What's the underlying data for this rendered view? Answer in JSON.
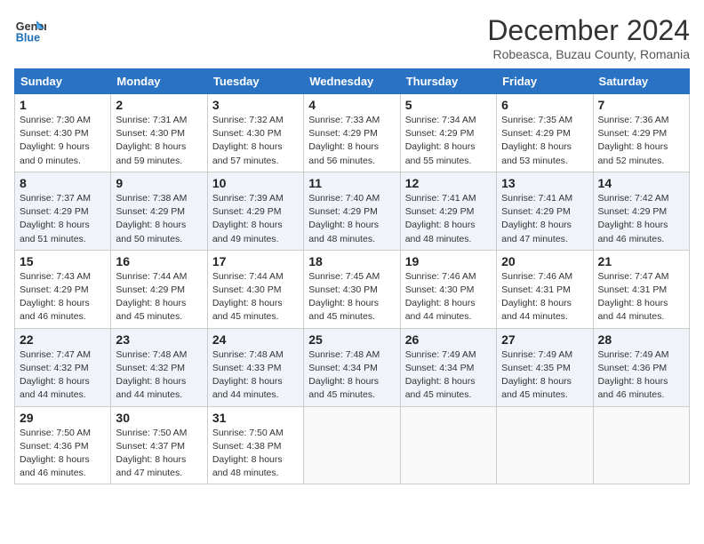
{
  "logo": {
    "line1": "General",
    "line2": "Blue"
  },
  "title": "December 2024",
  "location": "Robeasca, Buzau County, Romania",
  "weekdays": [
    "Sunday",
    "Monday",
    "Tuesday",
    "Wednesday",
    "Thursday",
    "Friday",
    "Saturday"
  ],
  "weeks": [
    [
      {
        "day": "1",
        "sunrise": "7:30 AM",
        "sunset": "4:30 PM",
        "daylight": "9 hours and 0 minutes."
      },
      {
        "day": "2",
        "sunrise": "7:31 AM",
        "sunset": "4:30 PM",
        "daylight": "8 hours and 59 minutes."
      },
      {
        "day": "3",
        "sunrise": "7:32 AM",
        "sunset": "4:30 PM",
        "daylight": "8 hours and 57 minutes."
      },
      {
        "day": "4",
        "sunrise": "7:33 AM",
        "sunset": "4:29 PM",
        "daylight": "8 hours and 56 minutes."
      },
      {
        "day": "5",
        "sunrise": "7:34 AM",
        "sunset": "4:29 PM",
        "daylight": "8 hours and 55 minutes."
      },
      {
        "day": "6",
        "sunrise": "7:35 AM",
        "sunset": "4:29 PM",
        "daylight": "8 hours and 53 minutes."
      },
      {
        "day": "7",
        "sunrise": "7:36 AM",
        "sunset": "4:29 PM",
        "daylight": "8 hours and 52 minutes."
      }
    ],
    [
      {
        "day": "8",
        "sunrise": "7:37 AM",
        "sunset": "4:29 PM",
        "daylight": "8 hours and 51 minutes."
      },
      {
        "day": "9",
        "sunrise": "7:38 AM",
        "sunset": "4:29 PM",
        "daylight": "8 hours and 50 minutes."
      },
      {
        "day": "10",
        "sunrise": "7:39 AM",
        "sunset": "4:29 PM",
        "daylight": "8 hours and 49 minutes."
      },
      {
        "day": "11",
        "sunrise": "7:40 AM",
        "sunset": "4:29 PM",
        "daylight": "8 hours and 48 minutes."
      },
      {
        "day": "12",
        "sunrise": "7:41 AM",
        "sunset": "4:29 PM",
        "daylight": "8 hours and 48 minutes."
      },
      {
        "day": "13",
        "sunrise": "7:41 AM",
        "sunset": "4:29 PM",
        "daylight": "8 hours and 47 minutes."
      },
      {
        "day": "14",
        "sunrise": "7:42 AM",
        "sunset": "4:29 PM",
        "daylight": "8 hours and 46 minutes."
      }
    ],
    [
      {
        "day": "15",
        "sunrise": "7:43 AM",
        "sunset": "4:29 PM",
        "daylight": "8 hours and 46 minutes."
      },
      {
        "day": "16",
        "sunrise": "7:44 AM",
        "sunset": "4:29 PM",
        "daylight": "8 hours and 45 minutes."
      },
      {
        "day": "17",
        "sunrise": "7:44 AM",
        "sunset": "4:30 PM",
        "daylight": "8 hours and 45 minutes."
      },
      {
        "day": "18",
        "sunrise": "7:45 AM",
        "sunset": "4:30 PM",
        "daylight": "8 hours and 45 minutes."
      },
      {
        "day": "19",
        "sunrise": "7:46 AM",
        "sunset": "4:30 PM",
        "daylight": "8 hours and 44 minutes."
      },
      {
        "day": "20",
        "sunrise": "7:46 AM",
        "sunset": "4:31 PM",
        "daylight": "8 hours and 44 minutes."
      },
      {
        "day": "21",
        "sunrise": "7:47 AM",
        "sunset": "4:31 PM",
        "daylight": "8 hours and 44 minutes."
      }
    ],
    [
      {
        "day": "22",
        "sunrise": "7:47 AM",
        "sunset": "4:32 PM",
        "daylight": "8 hours and 44 minutes."
      },
      {
        "day": "23",
        "sunrise": "7:48 AM",
        "sunset": "4:32 PM",
        "daylight": "8 hours and 44 minutes."
      },
      {
        "day": "24",
        "sunrise": "7:48 AM",
        "sunset": "4:33 PM",
        "daylight": "8 hours and 44 minutes."
      },
      {
        "day": "25",
        "sunrise": "7:48 AM",
        "sunset": "4:34 PM",
        "daylight": "8 hours and 45 minutes."
      },
      {
        "day": "26",
        "sunrise": "7:49 AM",
        "sunset": "4:34 PM",
        "daylight": "8 hours and 45 minutes."
      },
      {
        "day": "27",
        "sunrise": "7:49 AM",
        "sunset": "4:35 PM",
        "daylight": "8 hours and 45 minutes."
      },
      {
        "day": "28",
        "sunrise": "7:49 AM",
        "sunset": "4:36 PM",
        "daylight": "8 hours and 46 minutes."
      }
    ],
    [
      {
        "day": "29",
        "sunrise": "7:50 AM",
        "sunset": "4:36 PM",
        "daylight": "8 hours and 46 minutes."
      },
      {
        "day": "30",
        "sunrise": "7:50 AM",
        "sunset": "4:37 PM",
        "daylight": "8 hours and 47 minutes."
      },
      {
        "day": "31",
        "sunrise": "7:50 AM",
        "sunset": "4:38 PM",
        "daylight": "8 hours and 48 minutes."
      },
      null,
      null,
      null,
      null
    ]
  ],
  "labels": {
    "sunrise": "Sunrise:",
    "sunset": "Sunset:",
    "daylight": "Daylight:"
  }
}
